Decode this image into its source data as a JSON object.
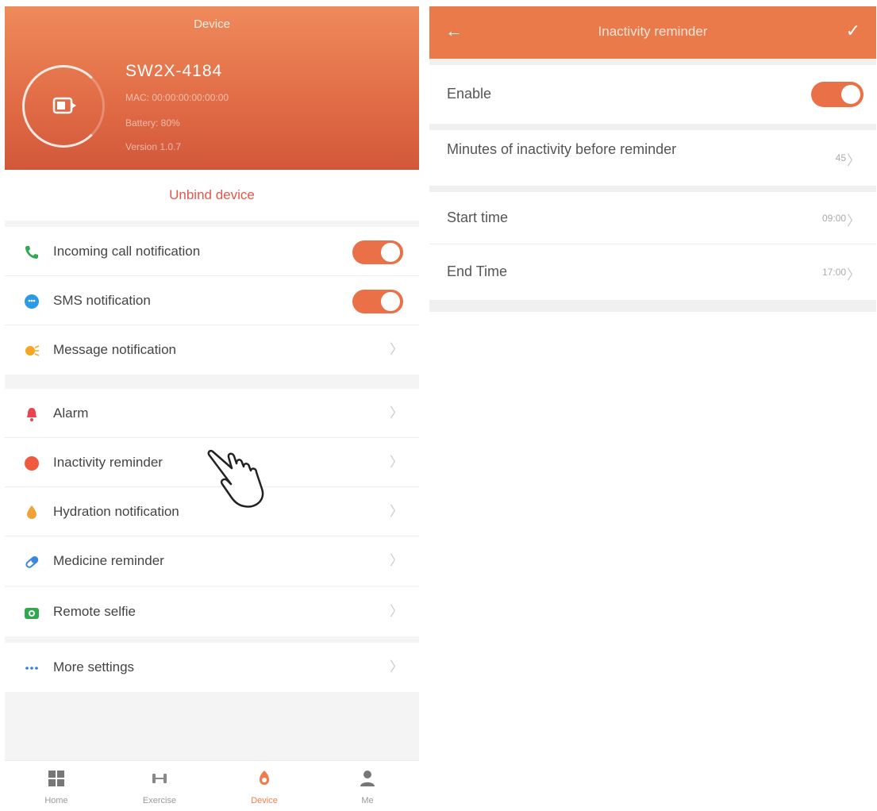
{
  "device_page": {
    "header": {
      "title": "Device",
      "device_name": "SW2X-4184",
      "info_lines": [
        "MAC: 00:00:00:00:00:00",
        "Battery: 80%",
        "Version 1.0.7"
      ]
    },
    "unbind_label": "Unbind device",
    "groups": [
      [
        {
          "name": "incoming-call",
          "icon": "phone-icon",
          "label": "Incoming call notification",
          "control": "toggle",
          "on": true
        },
        {
          "name": "sms",
          "icon": "sms-icon",
          "label": "SMS notification",
          "control": "toggle",
          "on": true
        },
        {
          "name": "message",
          "icon": "message-icon",
          "label": "Message notification",
          "control": "chevron"
        }
      ],
      [
        {
          "name": "alarm",
          "icon": "alarm-icon",
          "label": "Alarm",
          "control": "chevron"
        },
        {
          "name": "inactivity",
          "icon": "inactivity-icon",
          "label": "Inactivity reminder",
          "control": "chevron"
        },
        {
          "name": "hydration",
          "icon": "hydration-icon",
          "label": "Hydration notification",
          "control": "chevron"
        },
        {
          "name": "medicine",
          "icon": "pill-icon",
          "label": "Medicine reminder",
          "control": "chevron"
        }
      ],
      [
        {
          "name": "remote-selfie",
          "icon": "camera-icon",
          "label": "Remote selfie",
          "control": "chevron"
        }
      ],
      [
        {
          "name": "more-settings",
          "icon": "more-dots-icon",
          "label": "More settings",
          "control": "chevron"
        }
      ]
    ],
    "chevron": "〉",
    "tabs": [
      {
        "name": "home",
        "label": "Home",
        "icon": "grid-icon"
      },
      {
        "name": "exercise",
        "label": "Exercise",
        "icon": "dumbbell-icon"
      },
      {
        "name": "device",
        "label": "Device",
        "icon": "watch-icon",
        "active": true
      },
      {
        "name": "me",
        "label": "Me",
        "icon": "person-icon"
      }
    ]
  },
  "inactivity_page": {
    "title": "Inactivity reminder",
    "back": "←",
    "confirm": "✓",
    "rows": [
      {
        "name": "enable",
        "label": "Enable",
        "control": "toggle",
        "on": true
      },
      {
        "name": "minutes",
        "label": "Minutes of inactivity before reminder",
        "value": "45"
      },
      {
        "name": "start-time",
        "label": "Start time",
        "value": "09:00"
      },
      {
        "name": "end-time",
        "label": "End Time",
        "value": "17:00"
      }
    ]
  },
  "colors": {
    "accent": "#e97047",
    "header_gradient_top": "#ef8a5b",
    "header_gradient_bottom": "#d2573a",
    "unbind_text": "#e4554a"
  }
}
